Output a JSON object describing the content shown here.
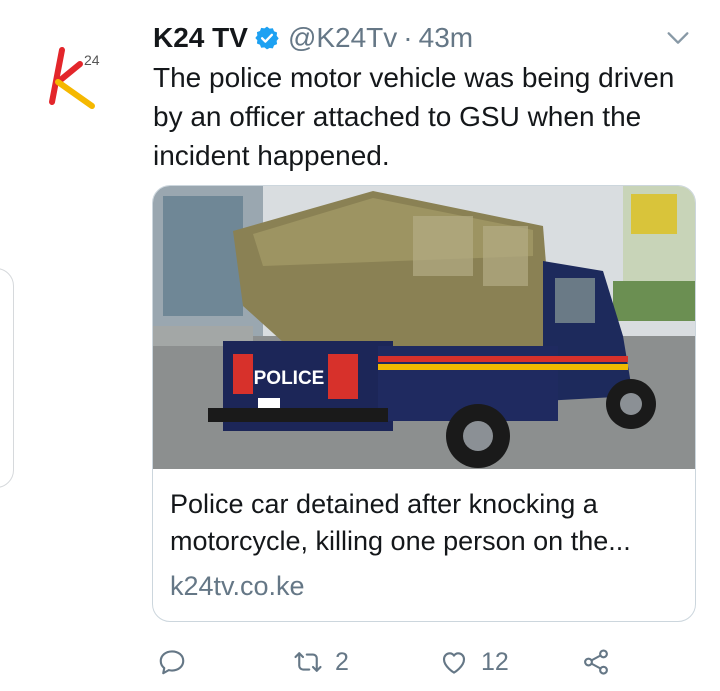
{
  "tweet": {
    "author_name": "K24 TV",
    "handle": "@K24Tv",
    "separator": "·",
    "time": "43m",
    "text": "The police motor vehicle was being driven by an officer attached to GSU when the incident happened.",
    "avatar_logo_text": "24"
  },
  "card": {
    "title": "Police car detained after knocking a motorcycle, killing one person on the...",
    "domain": "k24tv.co.ke",
    "image_text": {
      "police_sign": "POLICE"
    }
  },
  "actions": {
    "reply_icon": "reply-icon",
    "retweet_count": "2",
    "like_count": "12",
    "share_icon": "share-icon"
  },
  "colors": {
    "accent": "#1da1f2",
    "text": "#14171a",
    "secondary": "#657786",
    "border": "#ccd6dd",
    "brand_red": "#e3262b",
    "brand_yellow": "#f5b800"
  }
}
